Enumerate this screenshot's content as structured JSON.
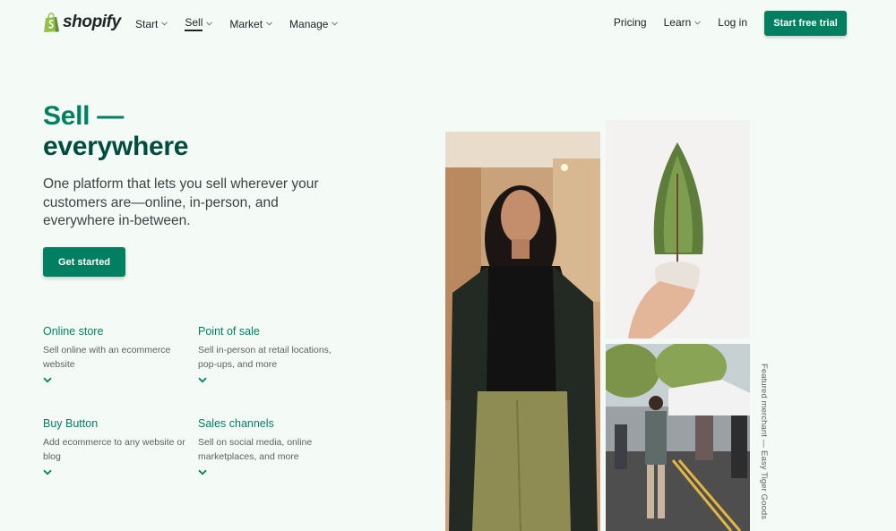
{
  "brand": {
    "name": "shopify"
  },
  "nav": {
    "left_items": [
      {
        "label": "Start",
        "has_dropdown": true,
        "active": false
      },
      {
        "label": "Sell",
        "has_dropdown": true,
        "active": true
      },
      {
        "label": "Market",
        "has_dropdown": true,
        "active": false
      },
      {
        "label": "Manage",
        "has_dropdown": true,
        "active": false
      }
    ],
    "right_items": [
      {
        "label": "Pricing",
        "has_dropdown": false
      },
      {
        "label": "Learn",
        "has_dropdown": true
      },
      {
        "label": "Log in",
        "has_dropdown": false
      }
    ],
    "cta_label": "Start free trial"
  },
  "hero": {
    "title_line1": "Sell —",
    "title_line2": "everywhere",
    "subtitle": "One platform that lets you sell wherever your customers are—online, in-person, and everywhere in-between.",
    "cta_label": "Get started"
  },
  "features": [
    {
      "title": "Online store",
      "description": "Sell online with an ecommerce website"
    },
    {
      "title": "Point of sale",
      "description": "Sell in-person at retail locations, pop-ups, and more"
    },
    {
      "title": "Buy Button",
      "description": "Add ecommerce to any website or blog"
    },
    {
      "title": "Sales channels",
      "description": "Sell on social media, online marketplaces, and more"
    }
  ],
  "images": {
    "caption": "Featured merchant — Easy Tiger Goods"
  },
  "colors": {
    "brand_green": "#008060",
    "dark_green": "#004c3f",
    "background": "#f4fbf6",
    "text": "#212326"
  },
  "icons": {
    "logo": "shopify-bag-icon",
    "dropdown": "chevron-down-icon",
    "expand": "chevron-down-icon"
  }
}
